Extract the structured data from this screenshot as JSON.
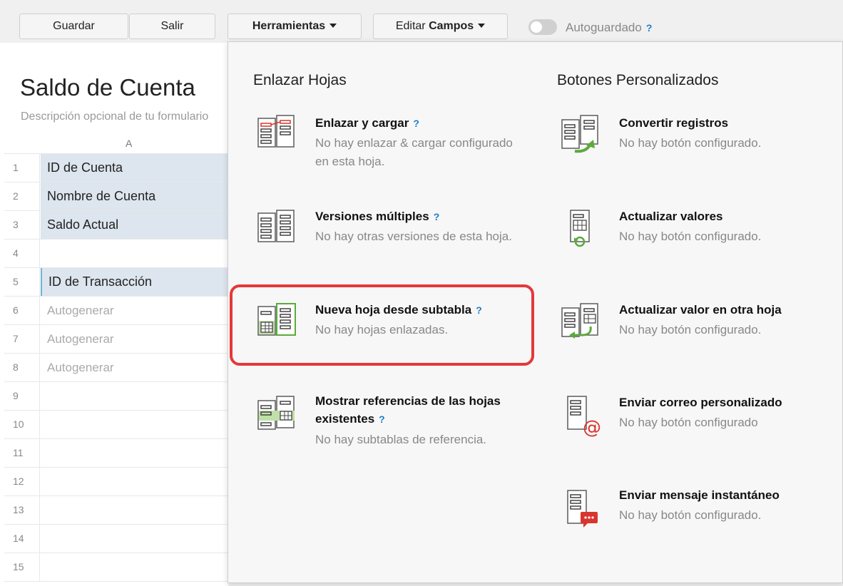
{
  "toolbar": {
    "save_label": "Guardar",
    "exit_label": "Salir",
    "tools_label": "Herramientas",
    "edit_prefix": "Editar",
    "edit_bold": "Campos",
    "autosave_label": "Autoguardado",
    "help_mark": "?"
  },
  "form": {
    "title": "Saldo de Cuenta",
    "description": "Descripción opcional de tu formulario"
  },
  "grid": {
    "column": "A",
    "rows": [
      {
        "num": "1",
        "value": "ID de Cuenta"
      },
      {
        "num": "2",
        "value": "Nombre de Cuenta"
      },
      {
        "num": "3",
        "value": "Saldo Actual"
      },
      {
        "num": "4",
        "value": ""
      },
      {
        "num": "5",
        "value": "ID de Transacción"
      },
      {
        "num": "6",
        "value": "Autogenerar"
      },
      {
        "num": "7",
        "value": "Autogenerar"
      },
      {
        "num": "8",
        "value": "Autogenerar"
      },
      {
        "num": "9",
        "value": ""
      },
      {
        "num": "10",
        "value": ""
      },
      {
        "num": "11",
        "value": ""
      },
      {
        "num": "12",
        "value": ""
      },
      {
        "num": "13",
        "value": ""
      },
      {
        "num": "14",
        "value": ""
      },
      {
        "num": "15",
        "value": ""
      }
    ]
  },
  "menu": {
    "link_sheets": {
      "title": "Enlazar Hojas",
      "items": [
        {
          "title": "Enlazar y cargar",
          "desc": "No hay enlazar & cargar configurado en esta hoja.",
          "icon": "link-load-icon"
        },
        {
          "title": "Versiones múltiples",
          "desc": "No hay otras versiones de esta hoja.",
          "icon": "multiple-versions-icon"
        },
        {
          "title": "Nueva hoja desde subtabla",
          "desc": "No hay hojas enlazadas.",
          "icon": "new-sheet-subtable-icon"
        },
        {
          "title": "Mostrar referencias de las hojas existentes",
          "desc": "No hay subtablas de referencia.",
          "icon": "show-references-icon"
        }
      ]
    },
    "custom_buttons": {
      "title": "Botones Personalizados",
      "items": [
        {
          "title": "Convertir registros",
          "desc": "No hay botón configurado.",
          "icon": "convert-records-icon"
        },
        {
          "title": "Actualizar valores",
          "desc": "No hay botón configurado.",
          "icon": "update-values-icon"
        },
        {
          "title": "Actualizar valor en otra hoja",
          "desc": "No hay botón configurado.",
          "icon": "update-other-sheet-icon"
        },
        {
          "title": "Enviar correo personalizado",
          "desc": "No hay botón configurado",
          "icon": "send-email-icon"
        },
        {
          "title": "Enviar mensaje instantáneo",
          "desc": "No hay botón configurado.",
          "icon": "send-message-icon"
        }
      ]
    }
  },
  "colors": {
    "accent_green": "#5aaa3c",
    "accent_red": "#d9352f",
    "help_blue": "#1a7ec8",
    "highlight_red": "#e5383b"
  }
}
